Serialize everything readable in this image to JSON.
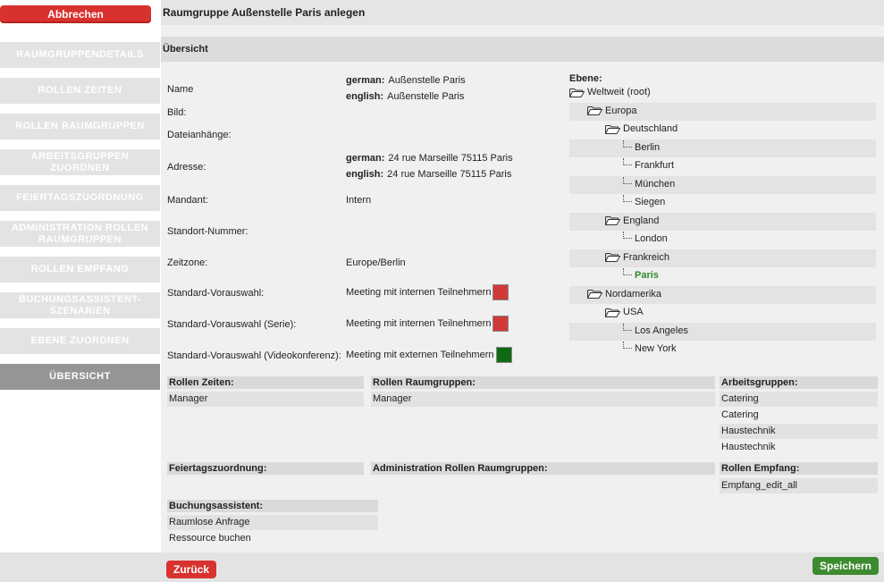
{
  "actions": {
    "cancel": "Abbrechen",
    "back": "Zurück",
    "save": "Speichern"
  },
  "header": {
    "title": "Raumgruppe Außenstelle Paris anlegen"
  },
  "section": {
    "title": "Übersicht"
  },
  "sidebar": {
    "items": [
      {
        "label": "RAUMGRUPPENDETAILS"
      },
      {
        "label": "ROLLEN ZEITEN"
      },
      {
        "label": "ROLLEN RAUMGRUPPEN"
      },
      {
        "label": "ARBEITSGRUPPEN ZUORDNEN"
      },
      {
        "label": "FEIERTAGSZUORDNUNG"
      },
      {
        "label": "ADMINISTRATION ROLLEN RAUMGRUPPEN"
      },
      {
        "label": "ROLLEN EMPFANG"
      },
      {
        "label": "BUCHUNGSASSISTENT-SZENARIEN"
      },
      {
        "label": "EBENE ZUORDNEN"
      },
      {
        "label": "ÜBERSICHT"
      }
    ]
  },
  "details": {
    "name_label": "Name",
    "name_german_key": "german:",
    "name_german": "Außenstelle Paris",
    "name_english_key": "english:",
    "name_english": "Außenstelle Paris",
    "image_label": "Bild:",
    "attachments_label": "Dateianhänge:",
    "address_label": "Adresse:",
    "address_german_key": "german:",
    "address_german": "24 rue Marseille 75115 Paris",
    "address_english_key": "english:",
    "address_english": "24 rue Marseille 75115 Paris",
    "client_label": "Mandant:",
    "client": "Intern",
    "site_number_label": "Standort-Nummer:",
    "timezone_label": "Zeitzone:",
    "timezone": "Europe/Berlin",
    "default1_label": "Standard-Vorauswahl:",
    "default1": "Meeting mit internen Teilnehmern",
    "default1_color": "#d03a3a",
    "default2_label": "Standard-Vorauswahl (Serie):",
    "default2": "Meeting mit internen Teilnehmern",
    "default2_color": "#d03a3a",
    "default3_label": "Standard-Vorauswahl (Videokonferenz):",
    "default3": "Meeting mit externen Teilnehmern",
    "default3_color": "#0f6a14"
  },
  "tree": {
    "title": "Ebene:",
    "nodes": [
      {
        "label": "Weltweit (root)"
      },
      {
        "label": "Europa"
      },
      {
        "label": "Deutschland"
      },
      {
        "label": "Berlin"
      },
      {
        "label": "Frankfurt"
      },
      {
        "label": "München"
      },
      {
        "label": "Siegen"
      },
      {
        "label": "England"
      },
      {
        "label": "London"
      },
      {
        "label": "Frankreich"
      },
      {
        "label": "Paris"
      },
      {
        "label": "Nordamerika"
      },
      {
        "label": "USA"
      },
      {
        "label": "Los Angeles"
      },
      {
        "label": "New York"
      }
    ]
  },
  "lists": {
    "rollen_zeiten": {
      "title": "Rollen Zeiten:",
      "items": [
        "Manager"
      ]
    },
    "rollen_raumgruppen": {
      "title": "Rollen Raumgruppen:",
      "items": [
        "Manager"
      ]
    },
    "arbeitsgruppen": {
      "title": "Arbeitsgruppen:",
      "items": [
        "Catering",
        "Catering",
        "Haustechnik",
        "Haustechnik"
      ]
    },
    "feiertage": {
      "title": "Feiertagszuordnung:",
      "items": []
    },
    "admin_rollen": {
      "title": "Administration Rollen Raumgruppen:",
      "items": []
    },
    "rollen_empfang": {
      "title": "Rollen Empfang:",
      "items": [
        "Empfang_edit_all"
      ]
    },
    "buchungsassistent": {
      "title": "Buchungsassistent:",
      "items": [
        "Raumlose Anfrage",
        "Ressource buchen"
      ]
    }
  }
}
